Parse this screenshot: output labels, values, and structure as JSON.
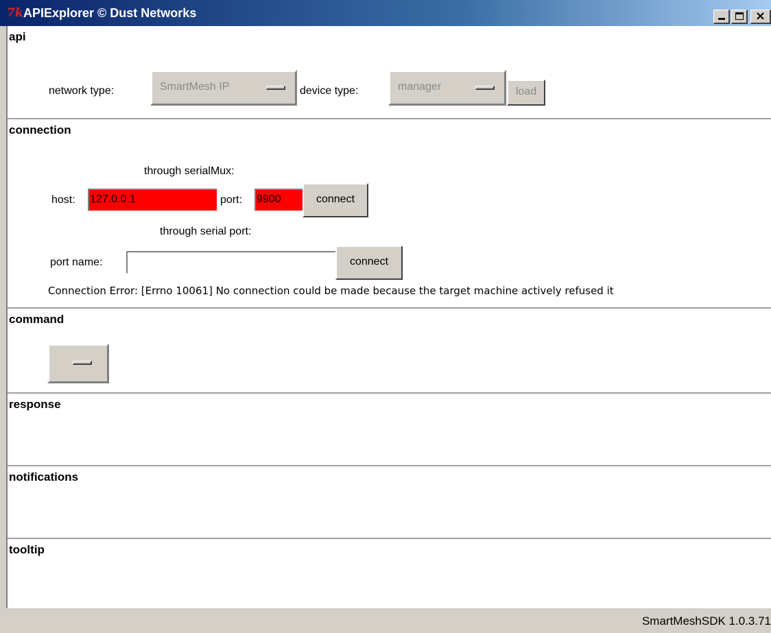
{
  "window": {
    "icon": "tk-feather-icon",
    "title": "APIExplorer © Dust Networks"
  },
  "api": {
    "title": "api",
    "network_type_label": "network type:",
    "network_type_value": "SmartMesh IP",
    "device_type_label": "device type:",
    "device_type_value": "manager",
    "load_label": "load"
  },
  "connection": {
    "title": "connection",
    "serialmux_heading": "through serialMux:",
    "host_label": "host:",
    "host_value": "127.0.0.1",
    "port_label": "port:",
    "port_value": "9900",
    "connect_label": "connect",
    "serial_heading": "through serial port:",
    "port_name_label": "port name:",
    "port_name_value": "",
    "serial_connect_label": "connect",
    "error_text": "Connection Error: [Errno 10061] No connection could be made because the target machine actively refused it"
  },
  "command": {
    "title": "command"
  },
  "response": {
    "title": "response"
  },
  "notifications": {
    "title": "notifications"
  },
  "tooltip": {
    "title": "tooltip"
  },
  "status": {
    "version": "SmartMeshSDK 1.0.3.71"
  },
  "colors": {
    "error_field": "#ff0000",
    "titlebar": "#0a246a",
    "chrome": "#d4d0c8"
  }
}
